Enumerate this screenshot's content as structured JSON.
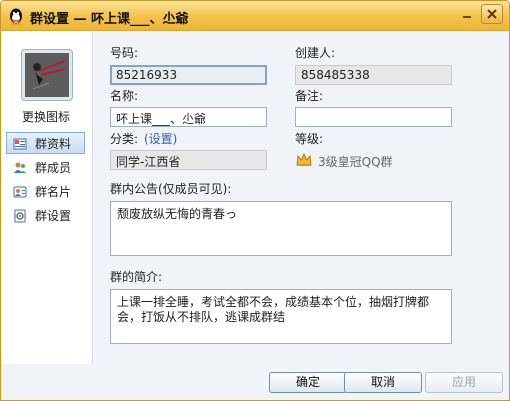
{
  "window": {
    "title": "群设置 — 吥上课___、尐爺",
    "colors": {
      "titlebar": "#f3c24a",
      "content_bg": "#f0f4f8",
      "link": "#2f5fb3"
    }
  },
  "sidebar": {
    "change_icon_label": "更换图标",
    "items": [
      {
        "label": "群资料",
        "icon": "group-info-icon",
        "active": true
      },
      {
        "label": "群成员",
        "icon": "group-members-icon",
        "active": false
      },
      {
        "label": "群名片",
        "icon": "group-card-icon",
        "active": false
      },
      {
        "label": "群设置",
        "icon": "group-settings-icon",
        "active": false
      }
    ]
  },
  "form": {
    "number_label": "号码:",
    "number_value": "85216933",
    "creator_label": "创建人:",
    "creator_value": "858485338",
    "name_label": "名称:",
    "name_value": "吥上课___、尐爺",
    "note_label": "备注:",
    "note_value": "",
    "category_label": "分类:",
    "category_link": "(设置)",
    "category_value": "同学-江西省",
    "level_label": "等级:",
    "level_value": "3级皇冠QQ群",
    "announcement_label": "群内公告(仅成员可见):",
    "announcement_value": "颓废放纵无悔的青春っ",
    "intro_label": "群的简介:",
    "intro_value": "上课一排全睡，考试全都不会，成绩基本个位，抽烟打牌都会，打饭从不排队，逃课成群结"
  },
  "buttons": {
    "ok": "确定",
    "cancel": "取消",
    "apply": "应用"
  }
}
